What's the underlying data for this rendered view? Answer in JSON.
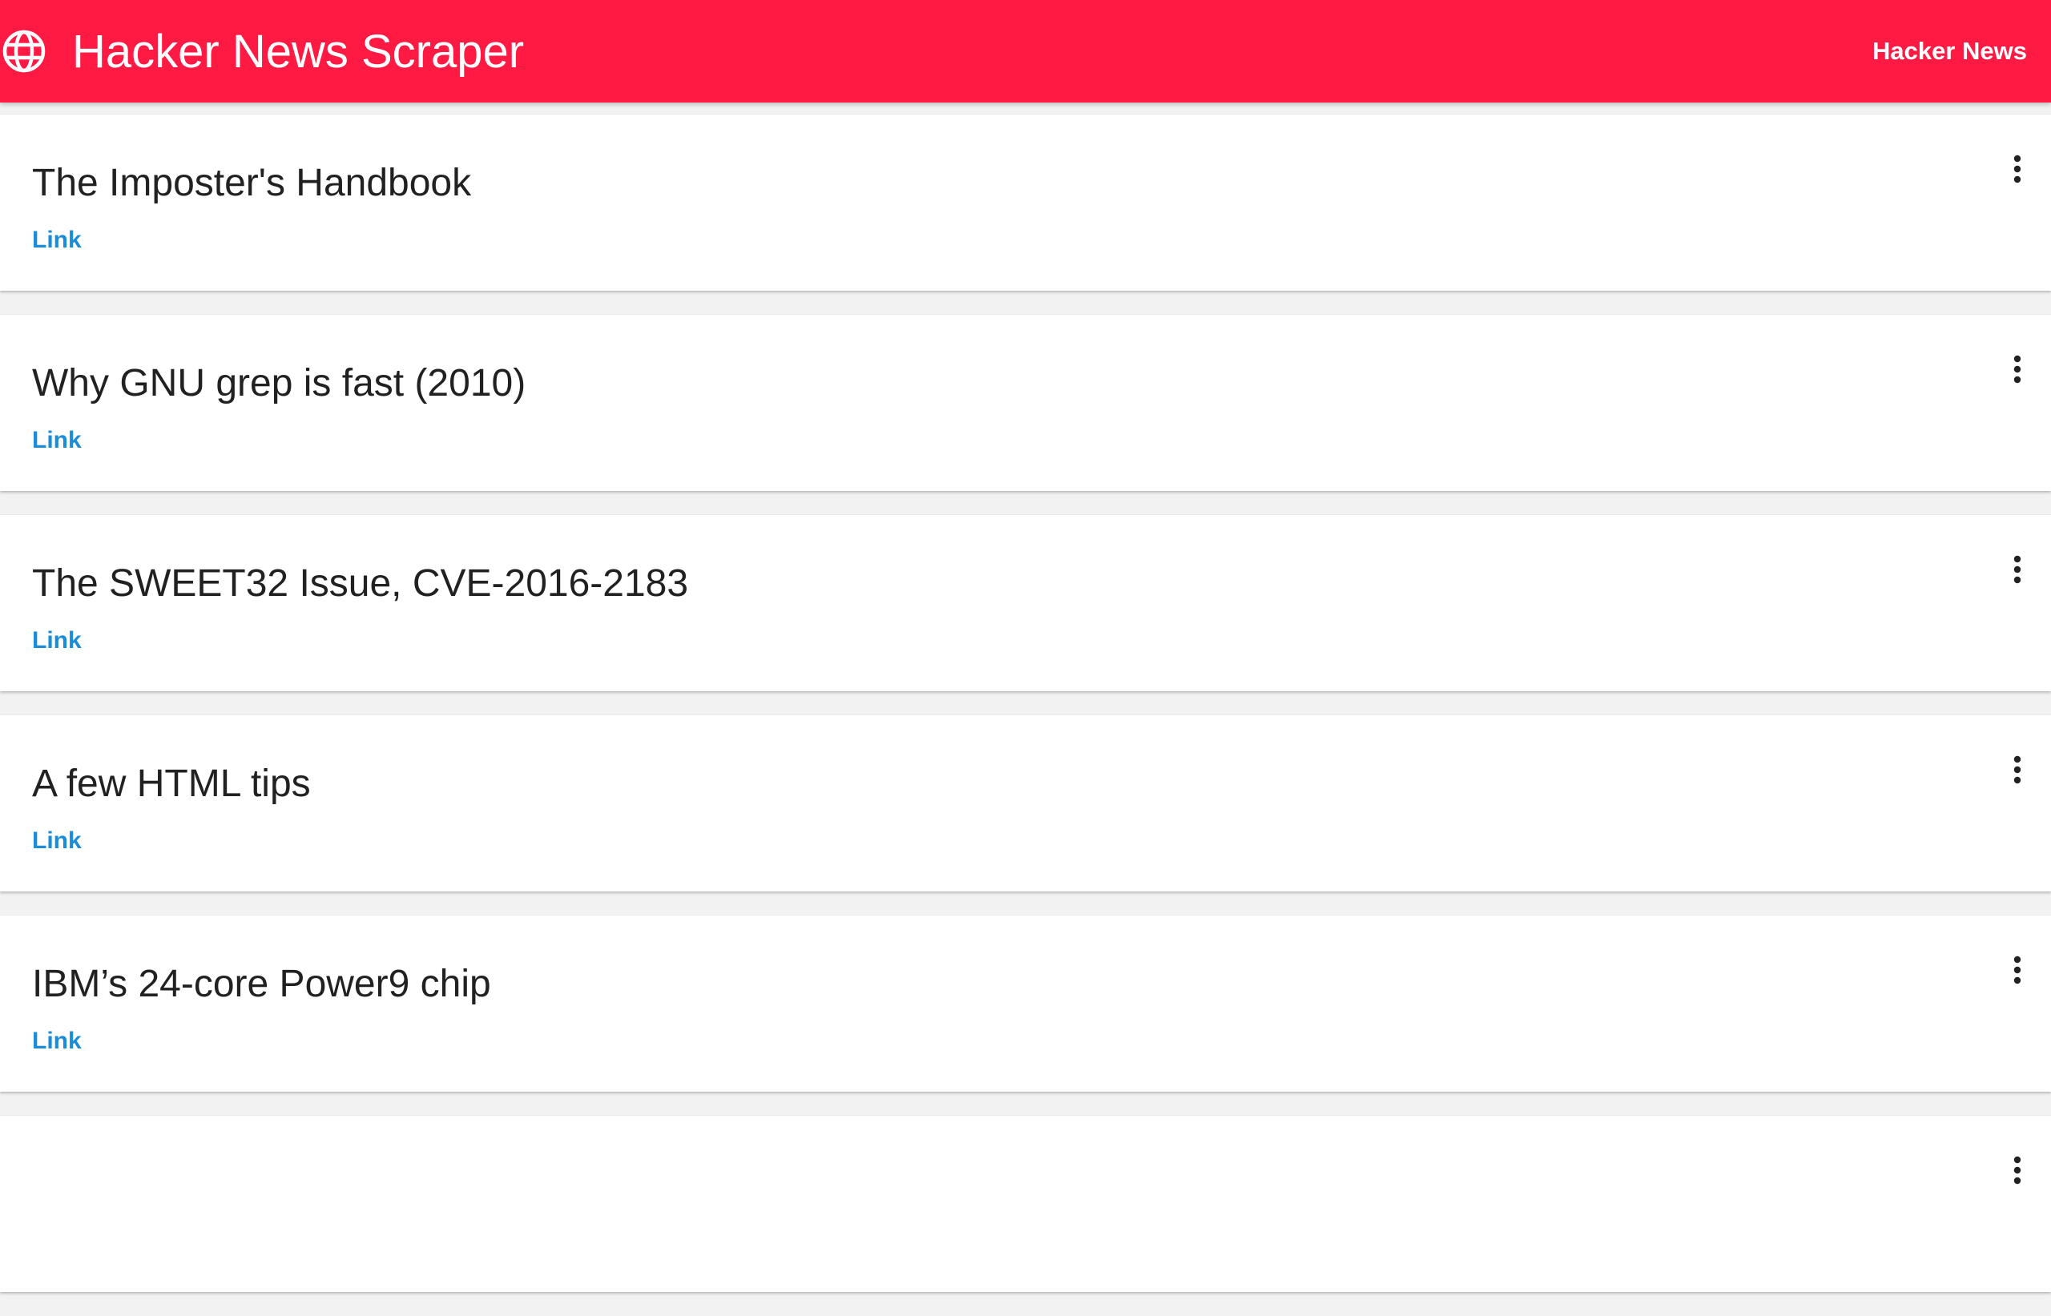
{
  "colors": {
    "app_bar": "#ff1a44",
    "link": "#1a8cd8",
    "title_text": "#212121"
  },
  "header": {
    "icon": "globe-icon",
    "title": "Hacker News Scraper",
    "nav_link": "Hacker News"
  },
  "stories": [
    {
      "title": "The Imposter's Handbook",
      "link_label": "Link",
      "menu_icon": "more-vert-icon"
    },
    {
      "title": "Why GNU grep is fast (2010)",
      "link_label": "Link",
      "menu_icon": "more-vert-icon"
    },
    {
      "title": "The SWEET32 Issue, CVE-2016-2183",
      "link_label": "Link",
      "menu_icon": "more-vert-icon"
    },
    {
      "title": "A few HTML tips",
      "link_label": "Link",
      "menu_icon": "more-vert-icon"
    },
    {
      "title": "IBM’s 24-core Power9 chip",
      "link_label": "Link",
      "menu_icon": "more-vert-icon"
    },
    {
      "title": "",
      "link_label": "",
      "menu_icon": "more-vert-icon"
    }
  ]
}
